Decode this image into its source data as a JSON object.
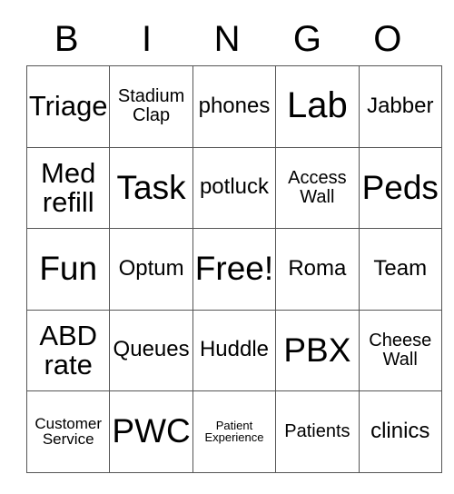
{
  "card": {
    "header_letters": [
      "B",
      "I",
      "N",
      "G",
      "O"
    ],
    "rows": [
      [
        {
          "text": "Triage",
          "size": "md"
        },
        {
          "text": "Stadium Clap",
          "size": "xs"
        },
        {
          "text": "phones",
          "size": "sm"
        },
        {
          "text": "Lab",
          "size": "xl"
        },
        {
          "text": "Jabber",
          "size": "sm"
        }
      ],
      [
        {
          "text": "Med refill",
          "size": "md"
        },
        {
          "text": "Task",
          "size": "lg"
        },
        {
          "text": "potluck",
          "size": "sm"
        },
        {
          "text": "Access Wall",
          "size": "xs"
        },
        {
          "text": "Peds",
          "size": "lg"
        }
      ],
      [
        {
          "text": "Fun",
          "size": "lg"
        },
        {
          "text": "Optum",
          "size": "sm"
        },
        {
          "text": "Free!",
          "size": "lg"
        },
        {
          "text": "Roma",
          "size": "sm"
        },
        {
          "text": "Team",
          "size": "sm"
        }
      ],
      [
        {
          "text": "ABD rate",
          "size": "md"
        },
        {
          "text": "Queues",
          "size": "sm"
        },
        {
          "text": "Huddle",
          "size": "sm"
        },
        {
          "text": "PBX",
          "size": "lg"
        },
        {
          "text": "Cheese Wall",
          "size": "xs"
        }
      ],
      [
        {
          "text": "Customer Service",
          "size": "xxs"
        },
        {
          "text": "PWC",
          "size": "lg"
        },
        {
          "text": "Patient Experience",
          "size": "tiny"
        },
        {
          "text": "Patients",
          "size": "xs"
        },
        {
          "text": "clinics",
          "size": "sm"
        }
      ]
    ],
    "free_space_label": "Free!",
    "colors": {
      "text": "#000000",
      "grid_line": "#555555",
      "background": "#ffffff"
    }
  }
}
